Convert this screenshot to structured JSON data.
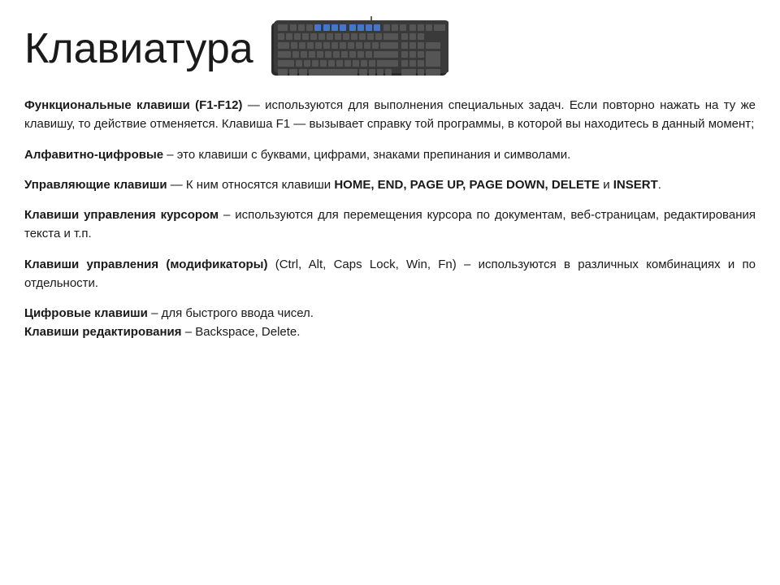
{
  "header": {
    "title": "Клавиатура"
  },
  "paragraphs": [
    {
      "id": "p1",
      "content": "p1"
    },
    {
      "id": "p2",
      "content": "p2"
    },
    {
      "id": "p3",
      "content": "p3"
    },
    {
      "id": "p4",
      "content": "p4"
    },
    {
      "id": "p5",
      "content": "p5"
    },
    {
      "id": "p6",
      "content": "p6"
    }
  ],
  "keyboard_image_alt": "keyboard"
}
